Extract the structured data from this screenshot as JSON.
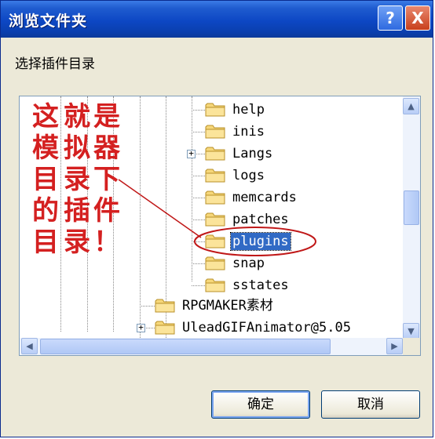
{
  "window": {
    "title": "浏览文件夹",
    "help_label": "?",
    "close_label": "X"
  },
  "instruction": "选择插件目录",
  "tree": {
    "items": [
      {
        "label": "help",
        "selected": false
      },
      {
        "label": "inis",
        "selected": false
      },
      {
        "label": "Langs",
        "selected": false,
        "expandable": true
      },
      {
        "label": "logs",
        "selected": false
      },
      {
        "label": "memcards",
        "selected": false
      },
      {
        "label": "patches",
        "selected": false
      },
      {
        "label": "plugins",
        "selected": true
      },
      {
        "label": "snap",
        "selected": false
      },
      {
        "label": "sstates",
        "selected": false
      },
      {
        "label": "RPGMAKER素材",
        "selected": false
      },
      {
        "label": "UleadGIFAnimator@5.05",
        "selected": false,
        "expandable": true
      }
    ]
  },
  "annotation": {
    "columns": [
      [
        "这",
        "模",
        "目",
        "的",
        "目"
      ],
      [
        "就",
        "拟",
        "录",
        "插",
        "录"
      ],
      [
        "是",
        "器",
        "下",
        "件",
        "！"
      ]
    ],
    "color": "#d42020"
  },
  "buttons": {
    "ok": "确定",
    "cancel": "取消"
  }
}
